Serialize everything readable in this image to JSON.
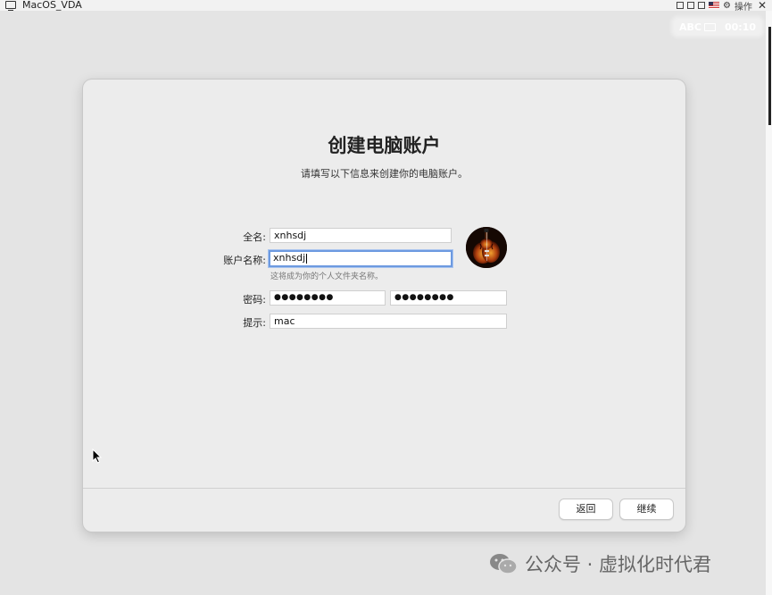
{
  "vm_window": {
    "title": "MacOS_VDA",
    "ops_label": "操作"
  },
  "status": {
    "input_source": "ABC",
    "clock": "00:10"
  },
  "setup": {
    "title": "创建电脑账户",
    "subtitle": "请填写以下信息来创建你的电脑账户。",
    "full_name_label": "全名:",
    "full_name_value": "xnhsdj",
    "account_name_label": "账户名称:",
    "account_name_value": "xnhsdj",
    "account_name_hint": "这将成为你的个人文件夹名称。",
    "password_label": "密码:",
    "password_value": "●●●●●●●●",
    "verify_value": "●●●●●●●●",
    "hint_label": "提示:",
    "hint_value": "mac",
    "back_button": "返回",
    "continue_button": "继续"
  },
  "watermark": {
    "text": "公众号 · 虚拟化时代君"
  },
  "colors": {
    "focus_ring": "#6d9ae0",
    "panel_bg": "#ececec",
    "desktop_bg": "#e4e4e4"
  }
}
